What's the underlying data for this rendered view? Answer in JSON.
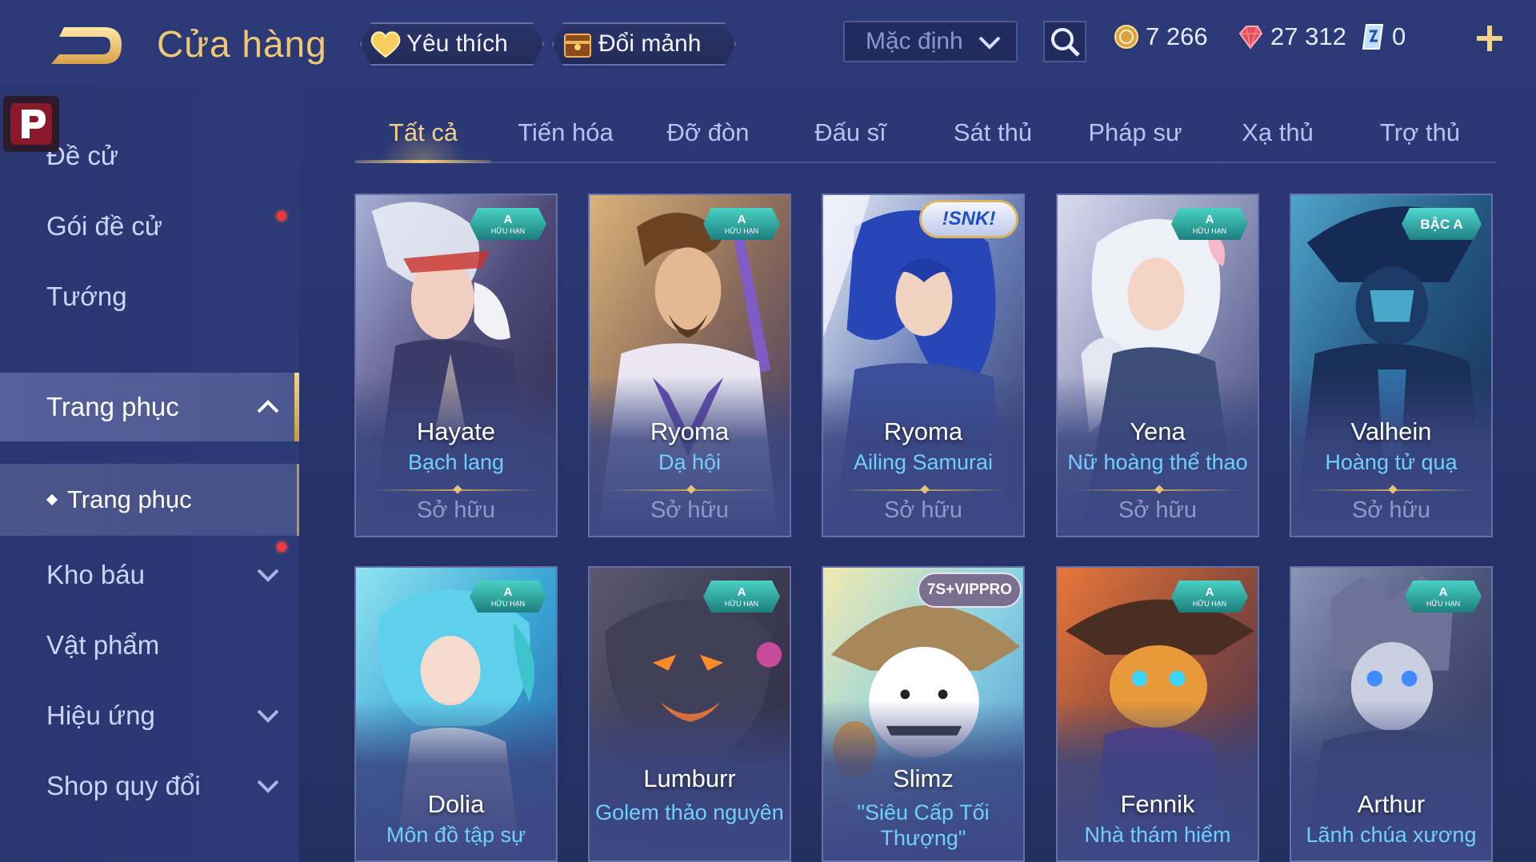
{
  "header": {
    "title": "Cửa hàng",
    "favorites_label": "Yêu thích",
    "shard_exchange_label": "Đổi mảnh",
    "sort": {
      "selected": "Mặc định"
    },
    "currencies": {
      "gold": "7 266",
      "gems": "27 312",
      "vouchers": "0"
    }
  },
  "sidebar": {
    "items": [
      {
        "label": "Đề cử"
      },
      {
        "label": "Gói đề cử"
      },
      {
        "label": "Tướng"
      },
      {
        "label": "Trang phục"
      },
      {
        "label": "Kho báu"
      },
      {
        "label": "Vật phẩm"
      },
      {
        "label": "Hiệu ứng"
      },
      {
        "label": "Shop quy đổi"
      }
    ],
    "subitem": {
      "label": "Trang phục"
    }
  },
  "tabs": [
    {
      "label": "Tất cả"
    },
    {
      "label": "Tiến hóa"
    },
    {
      "label": "Đỡ đòn"
    },
    {
      "label": "Đấu sĩ"
    },
    {
      "label": "Sát thủ"
    },
    {
      "label": "Pháp sư"
    },
    {
      "label": "Xạ thủ"
    },
    {
      "label": "Trợ thủ"
    }
  ],
  "badges": {
    "rank_a": "A",
    "rank_a_sub": "HỮU HẠN",
    "silver_a": "BẬC A",
    "snk": "!SNK!",
    "vip": "7S+VIPPRO"
  },
  "cards": [
    {
      "hero": "Hayate",
      "skin": "Bạch lang",
      "status": "Sở hữu"
    },
    {
      "hero": "Ryoma",
      "skin": "Dạ hội",
      "status": "Sở hữu"
    },
    {
      "hero": "Ryoma",
      "skin": "Ailing Samurai",
      "status": "Sở hữu"
    },
    {
      "hero": "Yena",
      "skin": "Nữ hoàng thể thao",
      "status": "Sở hữu"
    },
    {
      "hero": "Valhein",
      "skin": "Hoàng tử quạ",
      "status": "Sở hữu"
    },
    {
      "hero": "Dolia",
      "skin": "Môn đồ tập sự"
    },
    {
      "hero": "Lumburr",
      "skin": "Golem thảo nguyên"
    },
    {
      "hero": "Slimz",
      "skin": "\"Siêu Cấp Tối Thượng\""
    },
    {
      "hero": "Fennik",
      "skin": "Nhà thám hiểm"
    },
    {
      "hero": "Arthur",
      "skin": "Lãnh chúa xương"
    }
  ],
  "colors": {
    "accent_gold": "#f0c874",
    "skin_name_blue": "#6fd0ff",
    "background": "#2a3670",
    "notification_red": "#f03a3a"
  },
  "icons": [
    "back-arrow-icon",
    "heart-icon",
    "shard-chest-icon",
    "chevron-down-icon",
    "search-icon",
    "gold-coin-icon",
    "red-gem-icon",
    "voucher-icon",
    "plus-icon",
    "chevron-up-icon"
  ]
}
